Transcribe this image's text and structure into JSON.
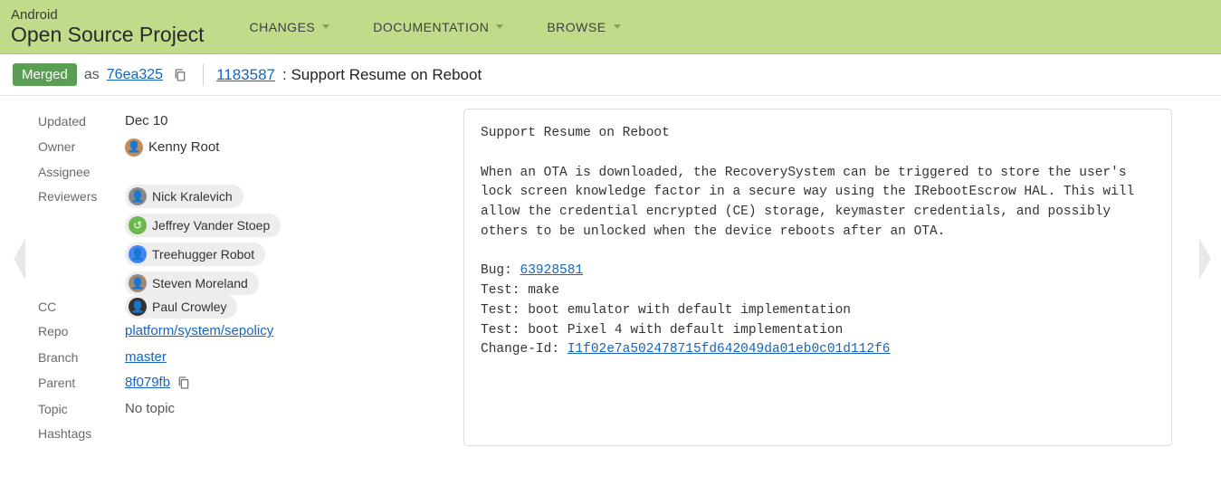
{
  "header": {
    "logo_top": "Android",
    "logo_bottom": "Open Source Project",
    "nav": [
      "CHANGES",
      "DOCUMENTATION",
      "BROWSE"
    ]
  },
  "subheader": {
    "status": "Merged",
    "as_text": "as",
    "commit_hash": "76ea325",
    "change_number": "1183587",
    "change_title": "Support Resume on Reboot"
  },
  "meta": {
    "updated_label": "Updated",
    "updated_value": "Dec 10",
    "owner_label": "Owner",
    "owner_name": "Kenny Root",
    "assignee_label": "Assignee",
    "reviewers_label": "Reviewers",
    "reviewers": [
      {
        "name": "Nick Kralevich",
        "avatar_bg": "#d7a57c"
      },
      {
        "name": "Jeffrey Vander Stoep",
        "avatar_bg": "#6db84d"
      },
      {
        "name": "Treehugger Robot",
        "avatar_bg": "#4285f4"
      },
      {
        "name": "Steven Moreland",
        "avatar_bg": "#9e8877"
      }
    ],
    "cc_label": "CC",
    "cc": [
      {
        "name": "Paul Crowley",
        "avatar_bg": "#333333"
      }
    ],
    "repo_label": "Repo",
    "repo_link": "platform/system/sepolicy",
    "branch_label": "Branch",
    "branch_link": "master",
    "parent_label": "Parent",
    "parent_hash": "8f079fb",
    "topic_label": "Topic",
    "topic_value": "No topic",
    "hashtags_label": "Hashtags"
  },
  "commit_message": {
    "title": "Support Resume on Reboot",
    "body": "When an OTA is downloaded, the RecoverySystem can be triggered to store the user's lock screen knowledge factor in a secure way using the IRebootEscrow HAL. This will allow the credential encrypted (CE) storage, keymaster credentials, and possibly others to be unlocked when the device reboots after an OTA.",
    "bug_prefix": "Bug: ",
    "bug_link": "63928581",
    "test1": "Test: make",
    "test2": "Test: boot emulator with default implementation",
    "test3": "Test: boot Pixel 4 with default implementation",
    "changeid_prefix": "Change-Id: ",
    "changeid_link": "I1f02e7a502478715fd642049da01eb0c01d112f6"
  }
}
